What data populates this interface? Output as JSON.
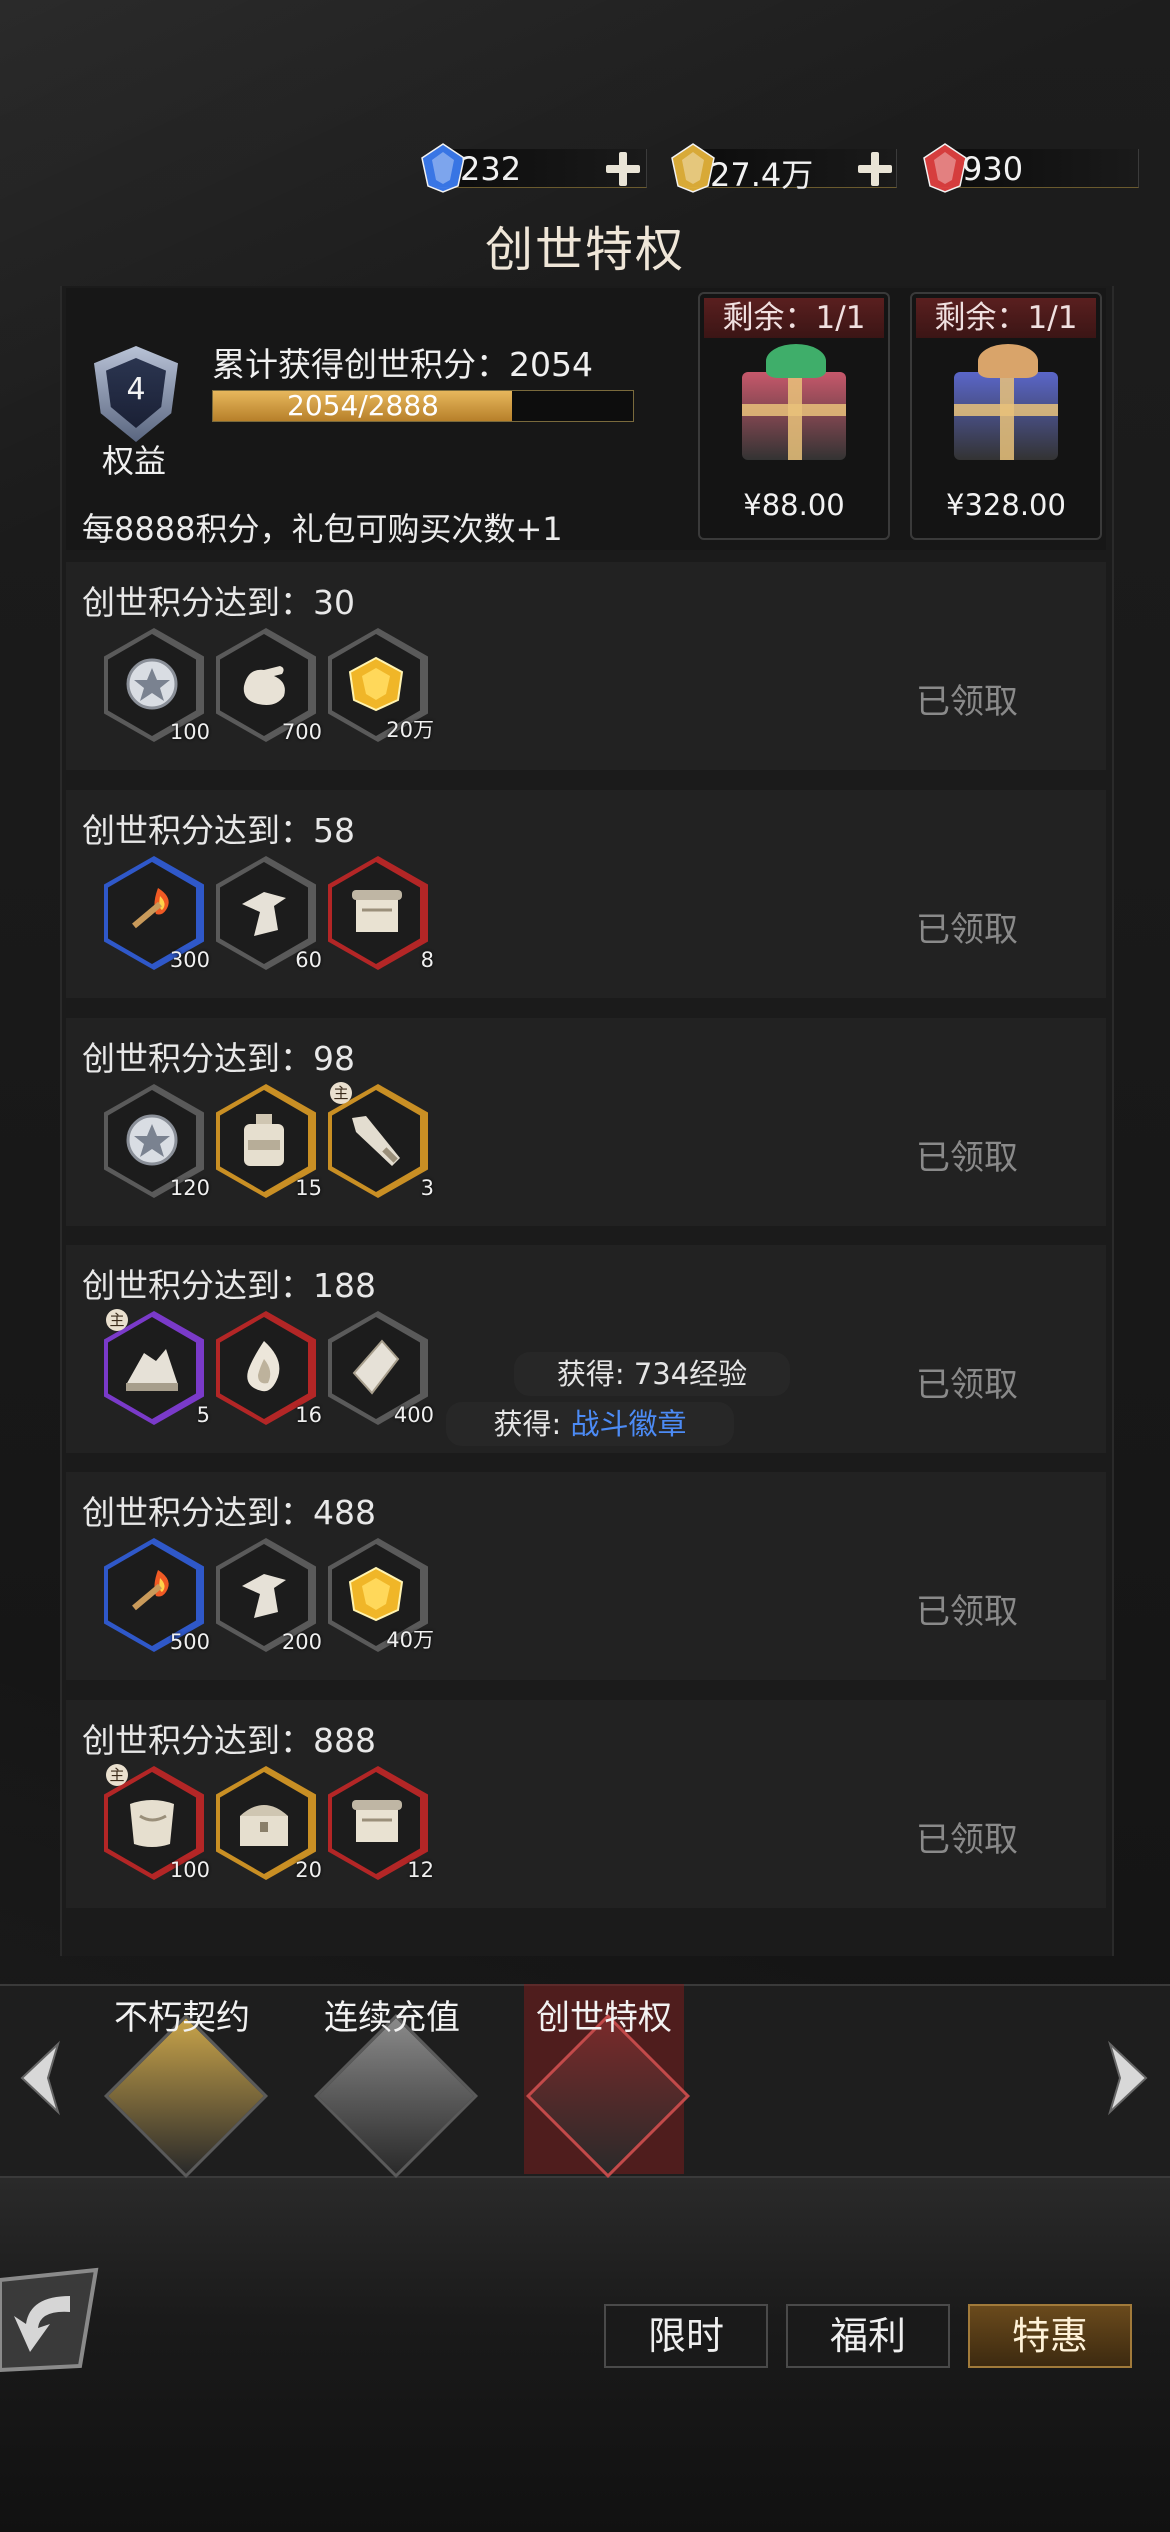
{
  "currencies": [
    {
      "name": "blue-gem",
      "value": "232",
      "color": "#3b7bf0"
    },
    {
      "name": "gold-gem",
      "value": "27.4万",
      "color": "#e3b23a"
    },
    {
      "name": "red-gem",
      "value": "930",
      "color": "#e04040"
    }
  ],
  "page": {
    "title": "创世特权"
  },
  "header": {
    "level": "4",
    "rights_label": "权益",
    "accum_label": "累计获得创世积分：2054",
    "progress_text": "2054/2888",
    "progress_ratio": 0.711,
    "rule": "每8888积分，礼包可购买次数+1",
    "gifts": [
      {
        "remaining": "剩余：1/1",
        "price": "¥88.00",
        "color": "#c7586b",
        "bow": "#3fae6a"
      },
      {
        "remaining": "剩余：1/1",
        "price": "¥328.00",
        "color": "#5a66c9",
        "bow": "#d9a46a"
      }
    ]
  },
  "milestones": [
    {
      "label": "创世积分达到：30",
      "status": "已领取",
      "items": [
        {
          "icon": "silver-coin-icon",
          "qty": "100",
          "frame": "#5a5a5a",
          "tag": ""
        },
        {
          "icon": "hand-icon",
          "qty": "700",
          "frame": "#5a5a5a",
          "tag": ""
        },
        {
          "icon": "gold-gem-icon",
          "qty": "20万",
          "frame": "#5a5a5a",
          "tag": ""
        }
      ]
    },
    {
      "label": "创世积分达到：58",
      "status": "已领取",
      "items": [
        {
          "icon": "torch-icon",
          "qty": "300",
          "frame": "#2f58c9",
          "tag": ""
        },
        {
          "icon": "fragment-icon",
          "qty": "60",
          "frame": "#5a5a5a",
          "tag": ""
        },
        {
          "icon": "scroll-icon",
          "qty": "8",
          "frame": "#b32626",
          "tag": ""
        }
      ]
    },
    {
      "label": "创世积分达到：98",
      "status": "已领取",
      "items": [
        {
          "icon": "silver-coin-icon",
          "qty": "120",
          "frame": "#5a5a5a",
          "tag": ""
        },
        {
          "icon": "potion-jar-icon",
          "qty": "15",
          "frame": "#c98f24",
          "tag": ""
        },
        {
          "icon": "weapon-icon",
          "qty": "3",
          "frame": "#c98f24",
          "tag": "主"
        }
      ]
    },
    {
      "label": "创世积分达到：188",
      "status": "已领取",
      "items": [
        {
          "icon": "ore-icon",
          "qty": "5",
          "frame": "#7a3ac9",
          "tag": "主"
        },
        {
          "icon": "flame-icon",
          "qty": "16",
          "frame": "#b32626",
          "tag": ""
        },
        {
          "icon": "crystal-icon",
          "qty": "400",
          "frame": "#5a5a5a",
          "tag": ""
        }
      ]
    },
    {
      "label": "创世积分达到：488",
      "status": "已领取",
      "items": [
        {
          "icon": "torch-icon",
          "qty": "500",
          "frame": "#2f58c9",
          "tag": ""
        },
        {
          "icon": "fragment-icon",
          "qty": "200",
          "frame": "#5a5a5a",
          "tag": ""
        },
        {
          "icon": "gold-gem-icon",
          "qty": "40万",
          "frame": "#5a5a5a",
          "tag": ""
        }
      ]
    },
    {
      "label": "创世积分达到：888",
      "status": "已领取",
      "items": [
        {
          "icon": "cloth-icon",
          "qty": "100",
          "frame": "#b32626",
          "tag": "主"
        },
        {
          "icon": "chest-icon",
          "qty": "20",
          "frame": "#c98f24",
          "tag": ""
        },
        {
          "icon": "scroll-icon",
          "qty": "12",
          "frame": "#b32626",
          "tag": ""
        }
      ]
    }
  ],
  "toasts": {
    "exp": "获得: 734经验",
    "prefix": "获得: ",
    "item": "战斗徽章"
  },
  "tabs": [
    {
      "label": "不朽契约",
      "color": "#c9a44a"
    },
    {
      "label": "连续充值",
      "color": "#8a8a8a"
    },
    {
      "label": "创世特权",
      "color": "#7a2a2a"
    }
  ],
  "bottom_buttons": [
    {
      "label": "限时"
    },
    {
      "label": "福利"
    },
    {
      "label": "特惠"
    }
  ]
}
